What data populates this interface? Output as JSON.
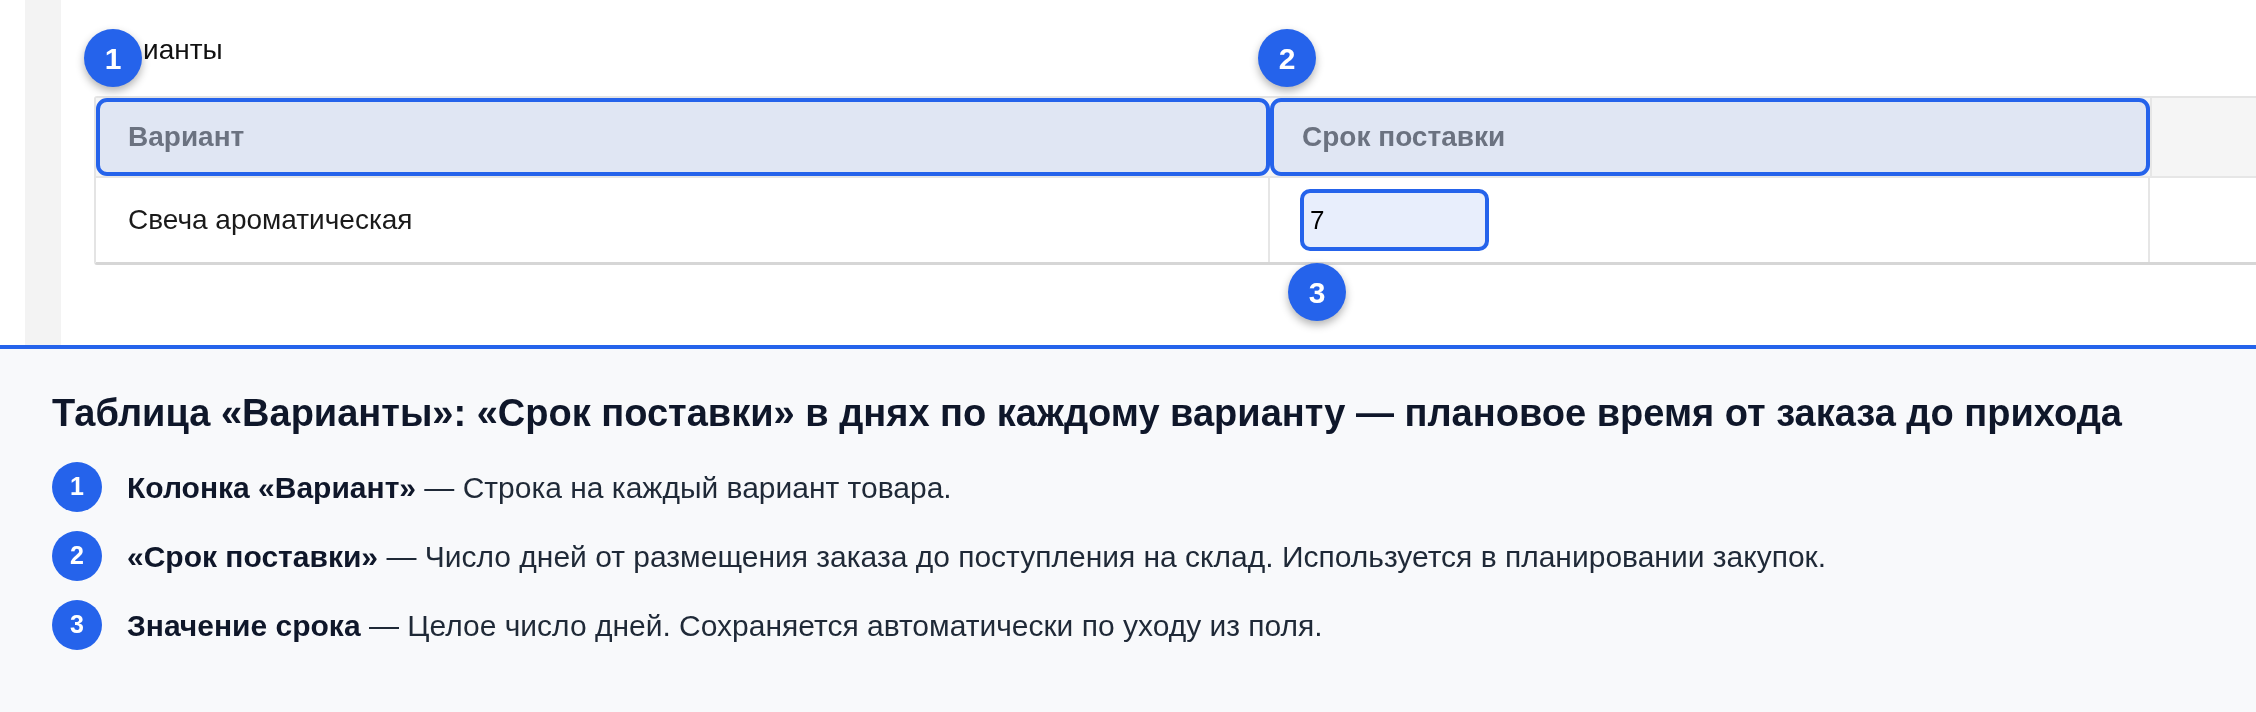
{
  "section_title": "ианты",
  "table": {
    "columns": [
      {
        "label": "Вариант",
        "highlighted": true,
        "callout": "1"
      },
      {
        "label": "Срок поставки",
        "highlighted": true,
        "callout": "2"
      }
    ],
    "rows": [
      {
        "variant": "Свеча ароматическая",
        "lead_time": {
          "value": "7",
          "highlighted": true,
          "callout": "3"
        }
      }
    ]
  },
  "legend": {
    "title": "Таблица «Варианты»: «Срок поставки» в днях по каждому варианту — плановое время от заказа до прихода",
    "items": [
      {
        "number": "1",
        "text": "**Колонка «Вариант»** — Строка на каждый вариант товара."
      },
      {
        "number": "2",
        "text": "**«Срок поставки»** — Число дней от размещения заказа до поступления на склад. Используется в планировании закупок."
      },
      {
        "number": "3",
        "text": "**Значение срока** — Целое число дней. Сохраняется автоматически по уходу из поля."
      }
    ]
  }
}
